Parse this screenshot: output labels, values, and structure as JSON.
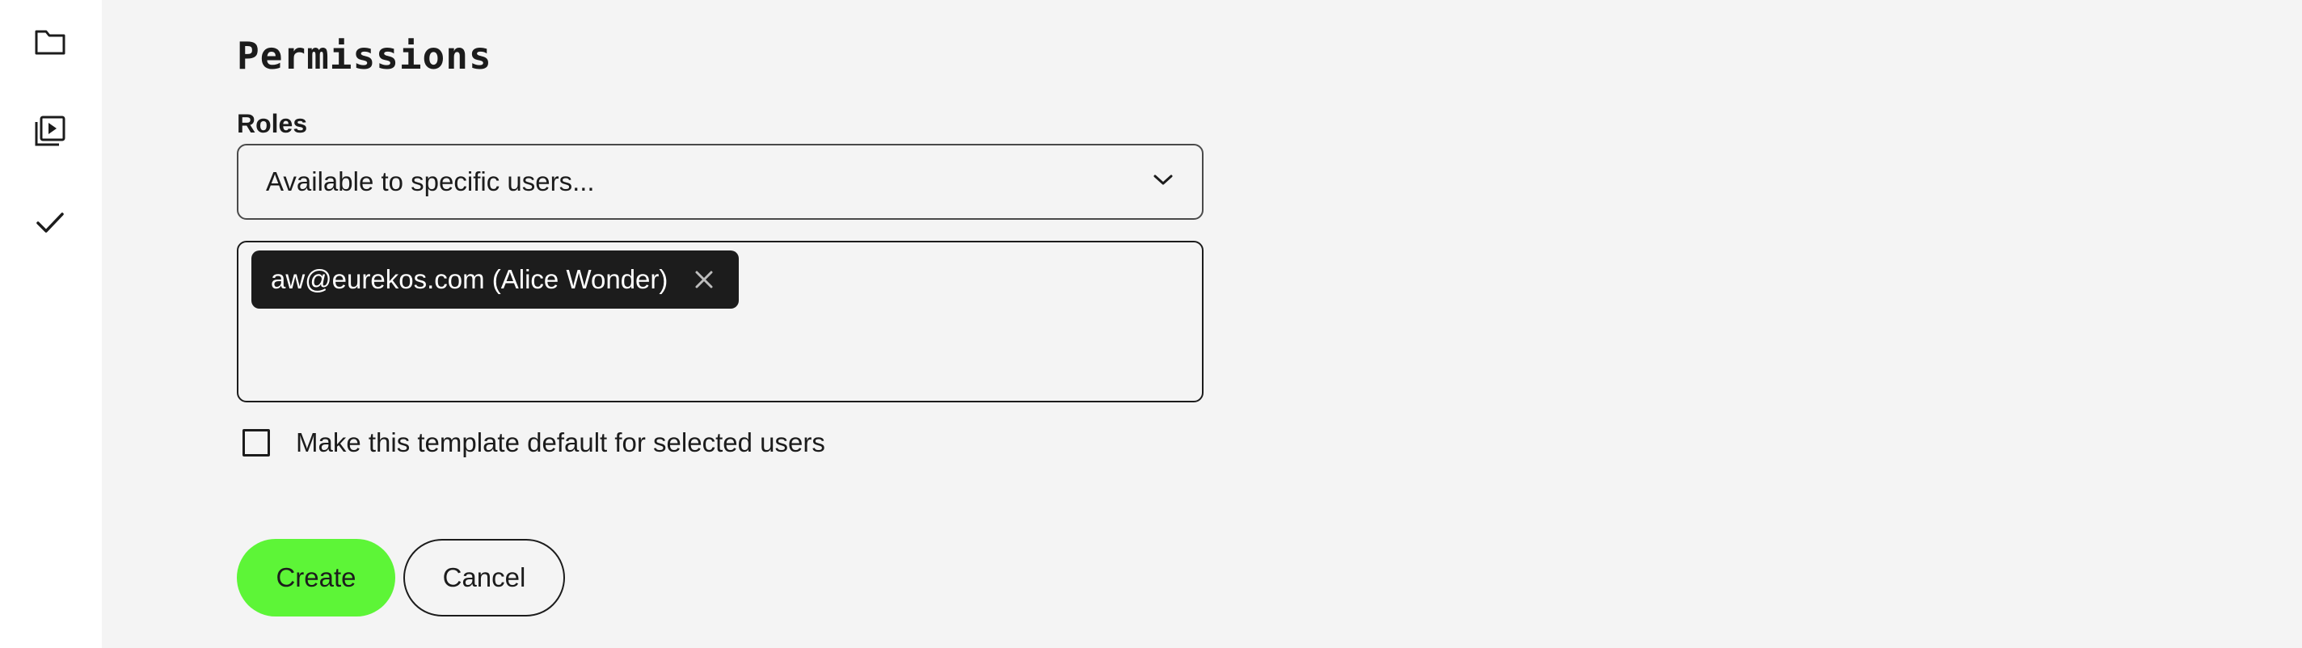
{
  "sidebar": {
    "items": [
      {
        "icon": "folder-icon"
      },
      {
        "icon": "video-library-icon"
      },
      {
        "icon": "checkmark-icon"
      }
    ]
  },
  "permissions": {
    "title": "Permissions",
    "roles_label": "Roles",
    "roles_select": {
      "selected": "Available to specific users..."
    },
    "selected_users": [
      {
        "label": "aw@eurekos.com (Alice Wonder)"
      }
    ],
    "default_checkbox": {
      "label": "Make this template default for selected users",
      "checked": false
    }
  },
  "actions": {
    "create_label": "Create",
    "cancel_label": "Cancel"
  },
  "colors": {
    "accent": "#5df537",
    "chip_background": "#1c1c1c",
    "page_background": "#f4f4f4",
    "sidebar_background": "#ffffff"
  }
}
